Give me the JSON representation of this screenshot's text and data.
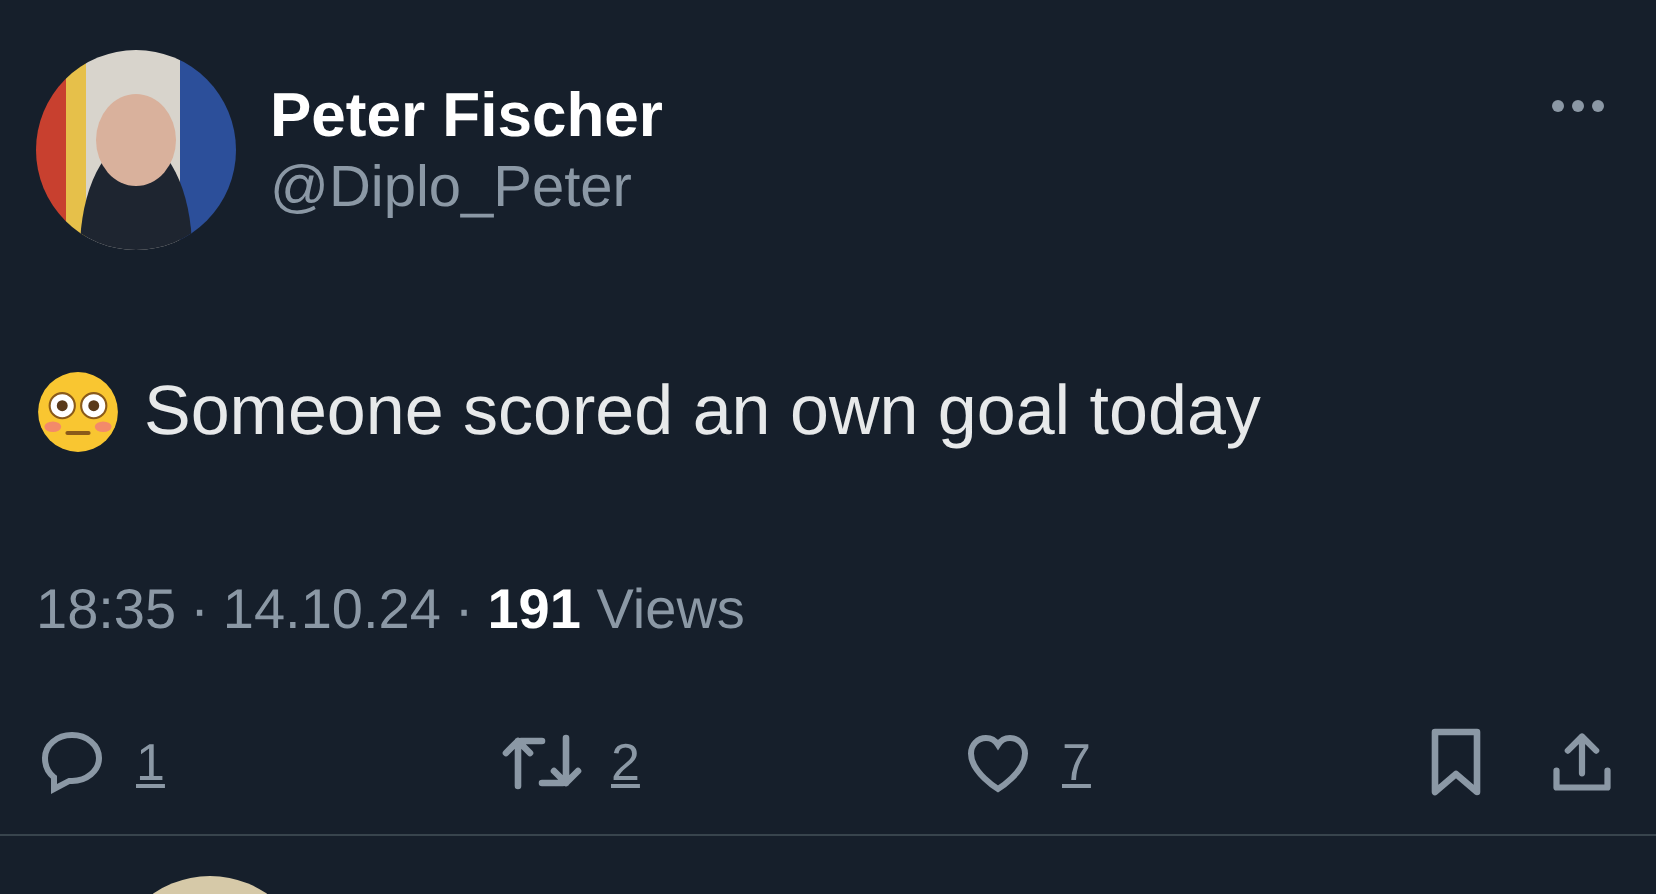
{
  "author": {
    "name": "Peter Fischer",
    "handle": "@Diplo_Peter"
  },
  "tweet": {
    "text": "Someone scored an own goal today"
  },
  "meta": {
    "time": "18:35",
    "separator_1": "·",
    "date": "14.10.24",
    "separator_2": "·",
    "views_count": "191",
    "views_label": "Views"
  },
  "actions": [
    {
      "kind": "reply",
      "count": "1"
    },
    {
      "kind": "retweet",
      "count": "2"
    },
    {
      "kind": "like",
      "count": "7"
    },
    {
      "kind": "bookmark"
    },
    {
      "kind": "share"
    }
  ]
}
